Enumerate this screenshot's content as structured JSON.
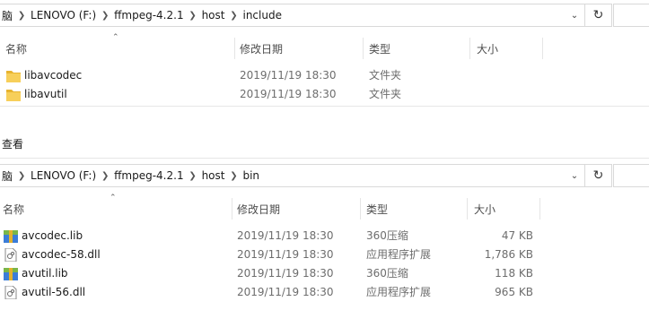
{
  "top": {
    "breadcrumbs": [
      "脑",
      "LENOVO (F:)",
      "ffmpeg-4.2.1",
      "host",
      "include"
    ],
    "columns": {
      "name": "名称",
      "date": "修改日期",
      "type": "类型",
      "size": "大小"
    },
    "files": [
      {
        "name": "libavcodec",
        "date": "2019/11/19 18:30",
        "type": "文件夹",
        "size": "",
        "icon": "folder-icon"
      },
      {
        "name": "libavutil",
        "date": "2019/11/19 18:30",
        "type": "文件夹",
        "size": "",
        "icon": "folder-icon"
      }
    ]
  },
  "ribbon": {
    "view_tab": "查看"
  },
  "bottom": {
    "breadcrumbs": [
      "脑",
      "LENOVO (F:)",
      "ffmpeg-4.2.1",
      "host",
      "bin"
    ],
    "columns": {
      "name": "名称",
      "date": "修改日期",
      "type": "类型",
      "size": "大小"
    },
    "files": [
      {
        "name": "avcodec.lib",
        "date": "2019/11/19 18:30",
        "type": "360压缩",
        "size": "47 KB",
        "icon": "archive-icon"
      },
      {
        "name": "avcodec-58.dll",
        "date": "2019/11/19 18:30",
        "type": "应用程序扩展",
        "size": "1,786 KB",
        "icon": "dll-file-icon"
      },
      {
        "name": "avutil.lib",
        "date": "2019/11/19 18:30",
        "type": "360压缩",
        "size": "118 KB",
        "icon": "archive-icon"
      },
      {
        "name": "avutil-56.dll",
        "date": "2019/11/19 18:30",
        "type": "应用程序扩展",
        "size": "965 KB",
        "icon": "dll-file-icon"
      }
    ]
  },
  "icons": {
    "refresh": "refresh-icon",
    "dropdown": "chevron-down-icon",
    "sort": "sort-up-icon",
    "separator": "chevron-right-icon"
  }
}
